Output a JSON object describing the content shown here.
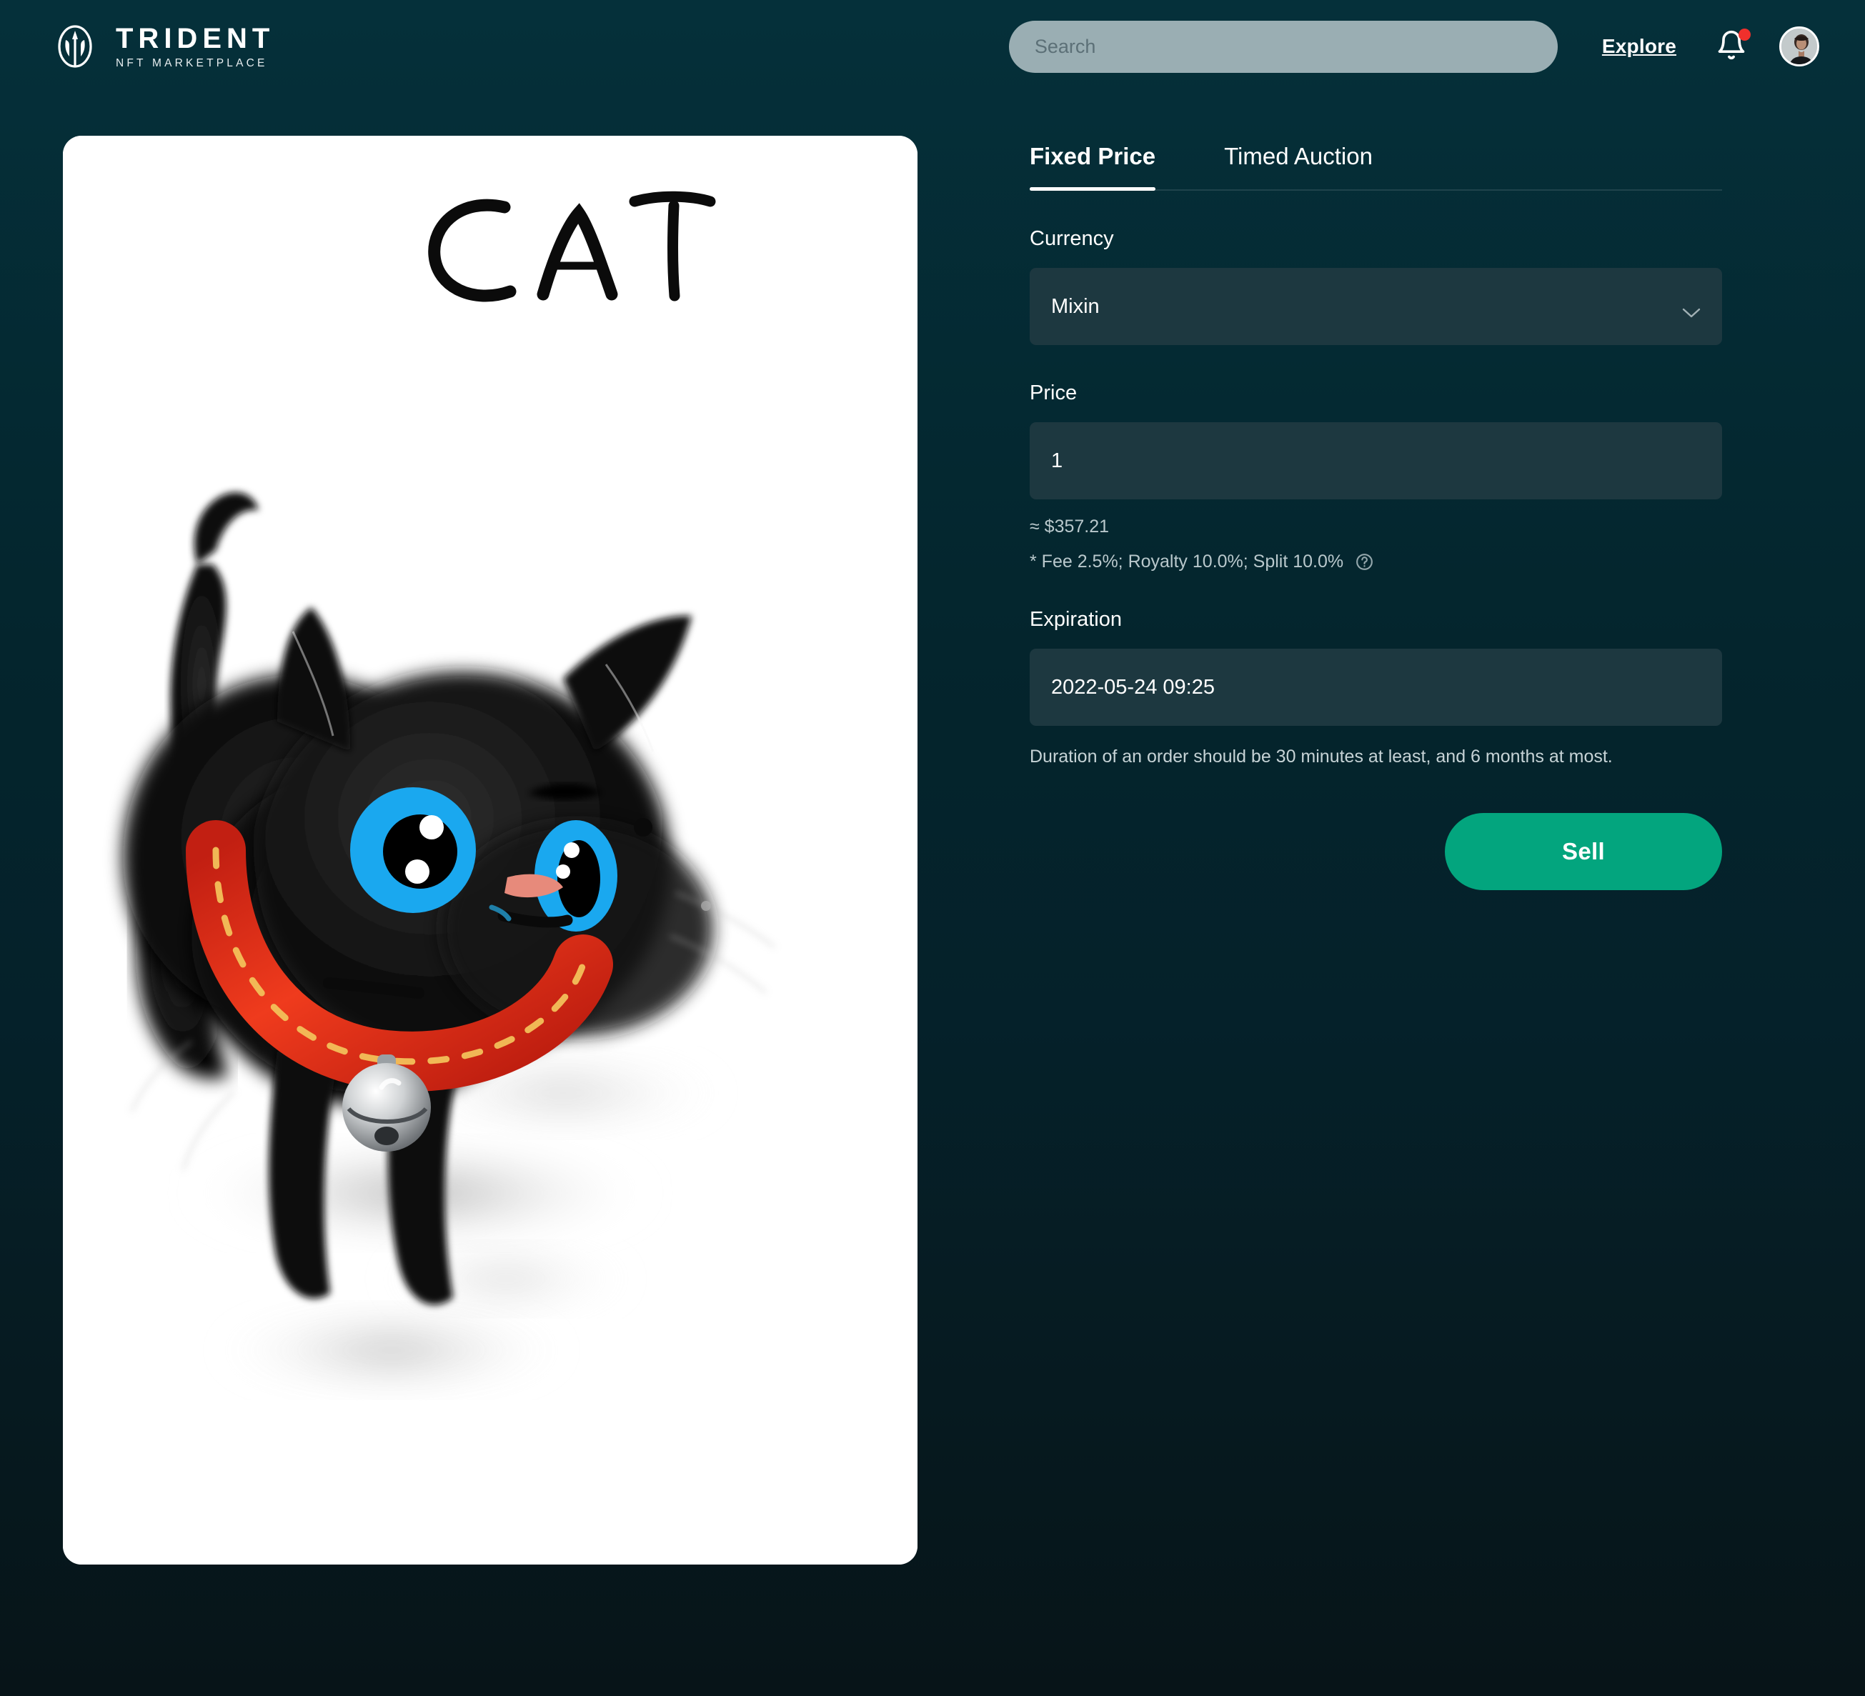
{
  "header": {
    "brand": {
      "title": "TRIDENT",
      "subtitle": "NFT MARKETPLACE",
      "logo_icon": "trident-in-oval-icon"
    },
    "search": {
      "placeholder": "Search",
      "value": ""
    },
    "explore_label": "Explore",
    "notifications": {
      "icon": "bell-icon",
      "has_unread": true,
      "dot_color": "#f0302c"
    },
    "avatar": {
      "icon": "user-avatar",
      "alt": "User profile photo"
    }
  },
  "preview": {
    "artwork_title_text": "CAT",
    "artwork_description": "Hand-drawn black kitten with bright blue eyes, pink nose and a red collar with yellow dashed stitching and a silver bell",
    "card_background": "#ffffff"
  },
  "form": {
    "tabs": [
      {
        "label": "Fixed Price",
        "active": true
      },
      {
        "label": "Timed Auction",
        "active": false
      }
    ],
    "currency": {
      "label": "Currency",
      "selected": "Mixin",
      "chevron_icon": "chevron-down-icon"
    },
    "price": {
      "label": "Price",
      "value": "1",
      "placeholder": "",
      "usd_estimate": "≈ $357.21",
      "fee_note": "* Fee 2.5%; Royalty 10.0%; Split 10.0%",
      "help_icon": "question-circle-icon"
    },
    "expiration": {
      "label": "Expiration",
      "value": "2022-05-24 09:25",
      "hint": "Duration of an order should be 30 minutes at least, and 6 months at most."
    },
    "submit": {
      "label": "Sell",
      "color": "#03a57e"
    }
  },
  "theme": {
    "background_top": "#05303a",
    "background_bottom": "#071418",
    "input_background": "#1d3840",
    "search_background": "#9aaeb3",
    "accent": "#03a57e",
    "text_primary": "#ffffff",
    "text_muted": "#b9c8cc"
  }
}
